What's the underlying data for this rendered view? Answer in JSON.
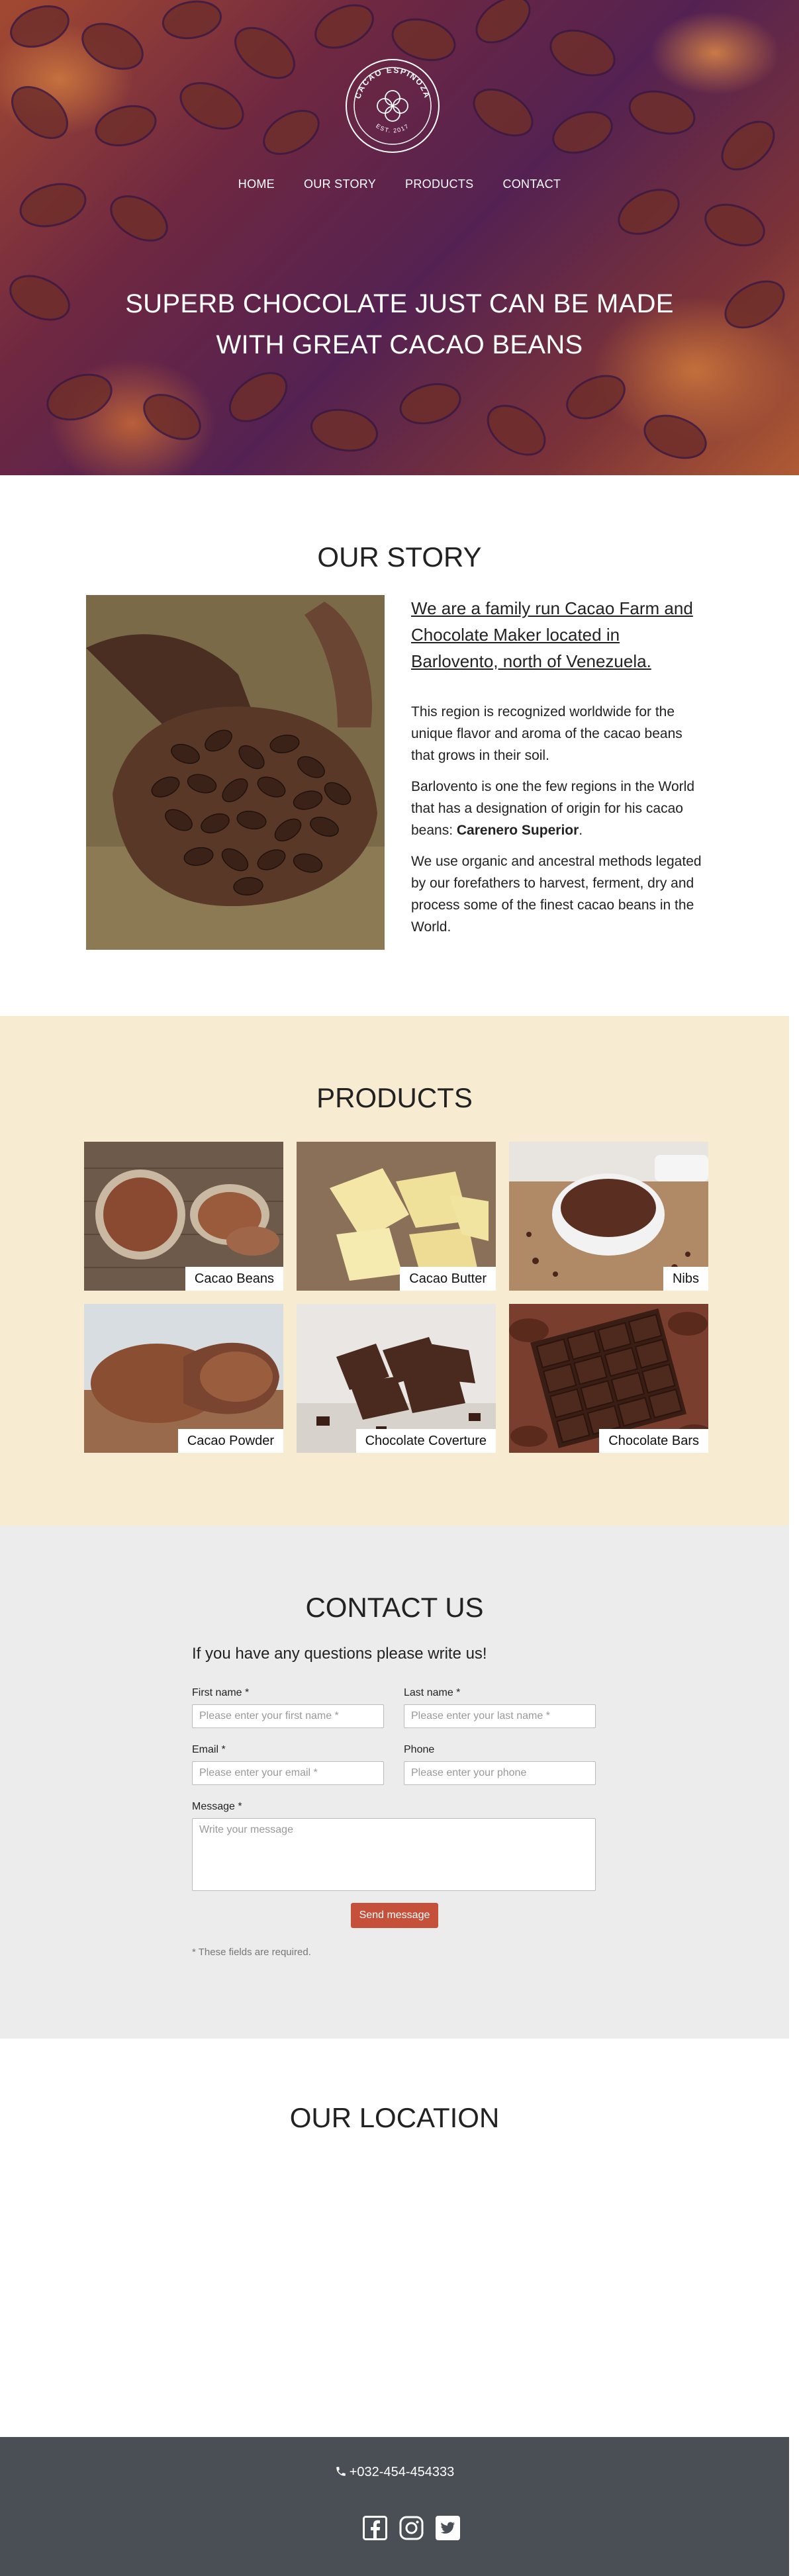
{
  "hero": {
    "logo_top_text": "CACAO ESPINOZA",
    "logo_bottom_text": "EST. 2017",
    "nav": [
      "HOME",
      "OUR STORY",
      "PRODUCTS",
      "CONTACT"
    ],
    "title_line1": "SUPERB CHOCOLATE JUST CAN BE MADE",
    "title_line2": "WITH GREAT CACAO BEANS"
  },
  "story": {
    "heading": "OUR STORY",
    "lead": "We are a family run Cacao Farm and Chocolate Maker located in Barlovento, north of Venezuela.",
    "p1": "This region is recognized worldwide for the unique flavor and aroma of the cacao beans that grows in their soil.",
    "p2_start": "Barlovento is one the few regions in the World that has a designation of origin for his cacao beans: ",
    "p2_bold": "Carenero Superior",
    "p2_end": ".",
    "p3": "We use organic and ancestral methods legated by our forefathers to harvest, ferment, dry and process some of the finest cacao beans in the World."
  },
  "products": {
    "heading": "PRODUCTS",
    "items": [
      {
        "label": "Cacao Beans"
      },
      {
        "label": "Cacao Butter"
      },
      {
        "label": "Nibs"
      },
      {
        "label": "Cacao Powder"
      },
      {
        "label": "Chocolate Coverture"
      },
      {
        "label": "Chocolate Bars"
      }
    ]
  },
  "contact": {
    "heading": "CONTACT US",
    "subheading": "If you have any questions please write us!",
    "first_name_label": "First name *",
    "first_name_placeholder": "Please enter your first name *",
    "last_name_label": "Last name *",
    "last_name_placeholder": "Please enter your last name *",
    "email_label": "Email *",
    "email_placeholder": "Please enter your email *",
    "phone_label": "Phone",
    "phone_placeholder": "Please enter your phone",
    "message_label": "Message *",
    "message_placeholder": "Write your message",
    "send_label": "Send message",
    "required_note": "* These fields are required."
  },
  "location": {
    "heading": "OUR LOCATION"
  },
  "footer": {
    "phone": "+032-454-454333",
    "social_icons": [
      "facebook-icon",
      "instagram-icon",
      "twitter-icon"
    ]
  },
  "colors": {
    "products_bg": "#f7ecd1",
    "contact_bg": "#ececec",
    "footer_bg": "#4a4f56",
    "button": "#c6513a"
  }
}
